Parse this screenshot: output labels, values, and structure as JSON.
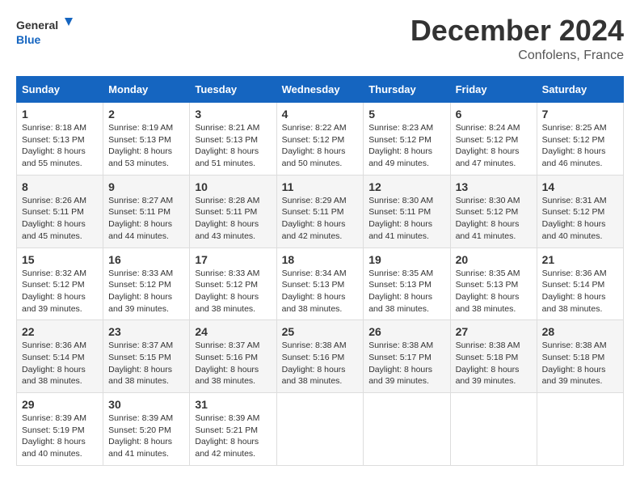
{
  "header": {
    "logo_general": "General",
    "logo_blue": "Blue",
    "month": "December 2024",
    "location": "Confolens, France"
  },
  "weekdays": [
    "Sunday",
    "Monday",
    "Tuesday",
    "Wednesday",
    "Thursday",
    "Friday",
    "Saturday"
  ],
  "weeks": [
    [
      {
        "day": "1",
        "info": "Sunrise: 8:18 AM\nSunset: 5:13 PM\nDaylight: 8 hours\nand 55 minutes."
      },
      {
        "day": "2",
        "info": "Sunrise: 8:19 AM\nSunset: 5:13 PM\nDaylight: 8 hours\nand 53 minutes."
      },
      {
        "day": "3",
        "info": "Sunrise: 8:21 AM\nSunset: 5:13 PM\nDaylight: 8 hours\nand 51 minutes."
      },
      {
        "day": "4",
        "info": "Sunrise: 8:22 AM\nSunset: 5:12 PM\nDaylight: 8 hours\nand 50 minutes."
      },
      {
        "day": "5",
        "info": "Sunrise: 8:23 AM\nSunset: 5:12 PM\nDaylight: 8 hours\nand 49 minutes."
      },
      {
        "day": "6",
        "info": "Sunrise: 8:24 AM\nSunset: 5:12 PM\nDaylight: 8 hours\nand 47 minutes."
      },
      {
        "day": "7",
        "info": "Sunrise: 8:25 AM\nSunset: 5:12 PM\nDaylight: 8 hours\nand 46 minutes."
      }
    ],
    [
      {
        "day": "8",
        "info": "Sunrise: 8:26 AM\nSunset: 5:11 PM\nDaylight: 8 hours\nand 45 minutes."
      },
      {
        "day": "9",
        "info": "Sunrise: 8:27 AM\nSunset: 5:11 PM\nDaylight: 8 hours\nand 44 minutes."
      },
      {
        "day": "10",
        "info": "Sunrise: 8:28 AM\nSunset: 5:11 PM\nDaylight: 8 hours\nand 43 minutes."
      },
      {
        "day": "11",
        "info": "Sunrise: 8:29 AM\nSunset: 5:11 PM\nDaylight: 8 hours\nand 42 minutes."
      },
      {
        "day": "12",
        "info": "Sunrise: 8:30 AM\nSunset: 5:11 PM\nDaylight: 8 hours\nand 41 minutes."
      },
      {
        "day": "13",
        "info": "Sunrise: 8:30 AM\nSunset: 5:12 PM\nDaylight: 8 hours\nand 41 minutes."
      },
      {
        "day": "14",
        "info": "Sunrise: 8:31 AM\nSunset: 5:12 PM\nDaylight: 8 hours\nand 40 minutes."
      }
    ],
    [
      {
        "day": "15",
        "info": "Sunrise: 8:32 AM\nSunset: 5:12 PM\nDaylight: 8 hours\nand 39 minutes."
      },
      {
        "day": "16",
        "info": "Sunrise: 8:33 AM\nSunset: 5:12 PM\nDaylight: 8 hours\nand 39 minutes."
      },
      {
        "day": "17",
        "info": "Sunrise: 8:33 AM\nSunset: 5:12 PM\nDaylight: 8 hours\nand 38 minutes."
      },
      {
        "day": "18",
        "info": "Sunrise: 8:34 AM\nSunset: 5:13 PM\nDaylight: 8 hours\nand 38 minutes."
      },
      {
        "day": "19",
        "info": "Sunrise: 8:35 AM\nSunset: 5:13 PM\nDaylight: 8 hours\nand 38 minutes."
      },
      {
        "day": "20",
        "info": "Sunrise: 8:35 AM\nSunset: 5:13 PM\nDaylight: 8 hours\nand 38 minutes."
      },
      {
        "day": "21",
        "info": "Sunrise: 8:36 AM\nSunset: 5:14 PM\nDaylight: 8 hours\nand 38 minutes."
      }
    ],
    [
      {
        "day": "22",
        "info": "Sunrise: 8:36 AM\nSunset: 5:14 PM\nDaylight: 8 hours\nand 38 minutes."
      },
      {
        "day": "23",
        "info": "Sunrise: 8:37 AM\nSunset: 5:15 PM\nDaylight: 8 hours\nand 38 minutes."
      },
      {
        "day": "24",
        "info": "Sunrise: 8:37 AM\nSunset: 5:16 PM\nDaylight: 8 hours\nand 38 minutes."
      },
      {
        "day": "25",
        "info": "Sunrise: 8:38 AM\nSunset: 5:16 PM\nDaylight: 8 hours\nand 38 minutes."
      },
      {
        "day": "26",
        "info": "Sunrise: 8:38 AM\nSunset: 5:17 PM\nDaylight: 8 hours\nand 39 minutes."
      },
      {
        "day": "27",
        "info": "Sunrise: 8:38 AM\nSunset: 5:18 PM\nDaylight: 8 hours\nand 39 minutes."
      },
      {
        "day": "28",
        "info": "Sunrise: 8:38 AM\nSunset: 5:18 PM\nDaylight: 8 hours\nand 39 minutes."
      }
    ],
    [
      {
        "day": "29",
        "info": "Sunrise: 8:39 AM\nSunset: 5:19 PM\nDaylight: 8 hours\nand 40 minutes."
      },
      {
        "day": "30",
        "info": "Sunrise: 8:39 AM\nSunset: 5:20 PM\nDaylight: 8 hours\nand 41 minutes."
      },
      {
        "day": "31",
        "info": "Sunrise: 8:39 AM\nSunset: 5:21 PM\nDaylight: 8 hours\nand 42 minutes."
      },
      null,
      null,
      null,
      null
    ]
  ]
}
